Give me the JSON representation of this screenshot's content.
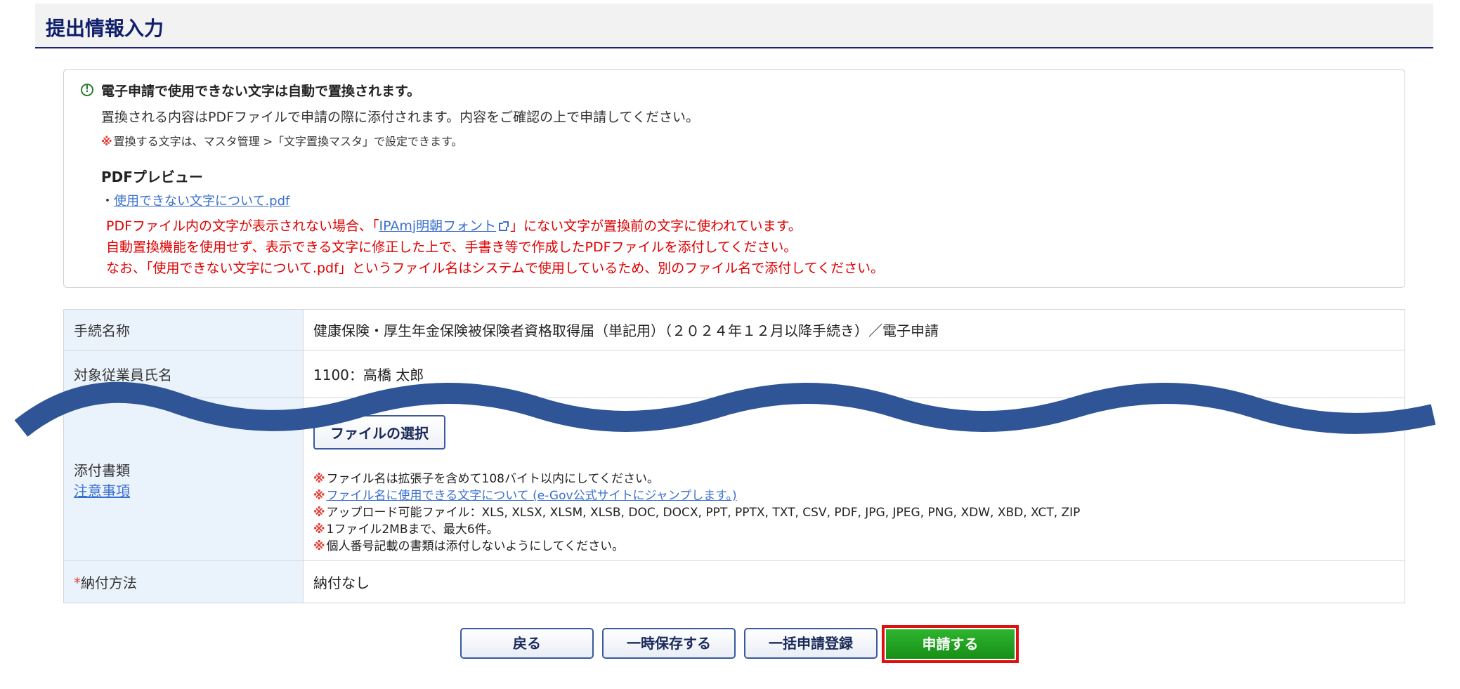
{
  "header": {
    "title": "提出情報入力"
  },
  "notice": {
    "title": "電子申請で使用できない文字は自動で置換されます。",
    "line1": "置換される内容はPDFファイルで申請の際に添付されます。内容をご確認の上で申請してください。",
    "mark": "※",
    "note": "置換する文字は、マスタ管理 >「文字置換マスタ」で設定できます。",
    "pdf_heading": "PDFプレビュー",
    "pdf_bullet": "・",
    "pdf_link": "使用できない文字について.pdf",
    "red1_pre": "PDFファイル内の文字が表示されない場合、「",
    "red1_link": "IPAmj明朝フォント",
    "red1_post": "」にない文字が置換前の文字に使われています。",
    "red2": "自動置換機能を使用せず、表示できる文字に修正した上で、手書き等で作成したPDFファイルを添付してください。",
    "red3": "なお、「使用できない文字について.pdf」というファイル名はシステムで使用しているため、別のファイル名で添付してください。"
  },
  "table": {
    "row1_label": "手続名称",
    "row1_value": "健康保険・厚生年金保険被保険者資格取得届（単記用）（２０２４年１２月以降手続き）／電子申請",
    "row2_label": "対象従業員氏名",
    "row2_value": "1100：高橋 太郎",
    "row3_label": "添付書類",
    "row3_link": "注意事項",
    "file_button": "ファイルの選択",
    "notes": [
      "ファイル名は拡張子を含めて108バイト以内にしてください。",
      "ファイル名に使用できる文字について (e-Gov公式サイトにジャンプします。)",
      "アップロード可能ファイル：XLS, XLSX, XLSM, XLSB, DOC, DOCX, PPT, PPTX, TXT, CSV, PDF, JPG, JPEG, PNG, XDW, XBD, XCT, ZIP",
      "1ファイル2MBまで、最大6件。",
      "個人番号記載の書類は添付しないようにしてください。"
    ],
    "row4_required": "*",
    "row4_label": "納付方法",
    "row4_value": "納付なし"
  },
  "buttons": {
    "back": "戻る",
    "save": "一時保存する",
    "bulk": "一括申請登録",
    "submit": "申請する"
  },
  "colors": {
    "accent": "#1a237e",
    "wave": "#2f5597",
    "submit": "#1f9e1f",
    "highlight": "#e01010"
  }
}
